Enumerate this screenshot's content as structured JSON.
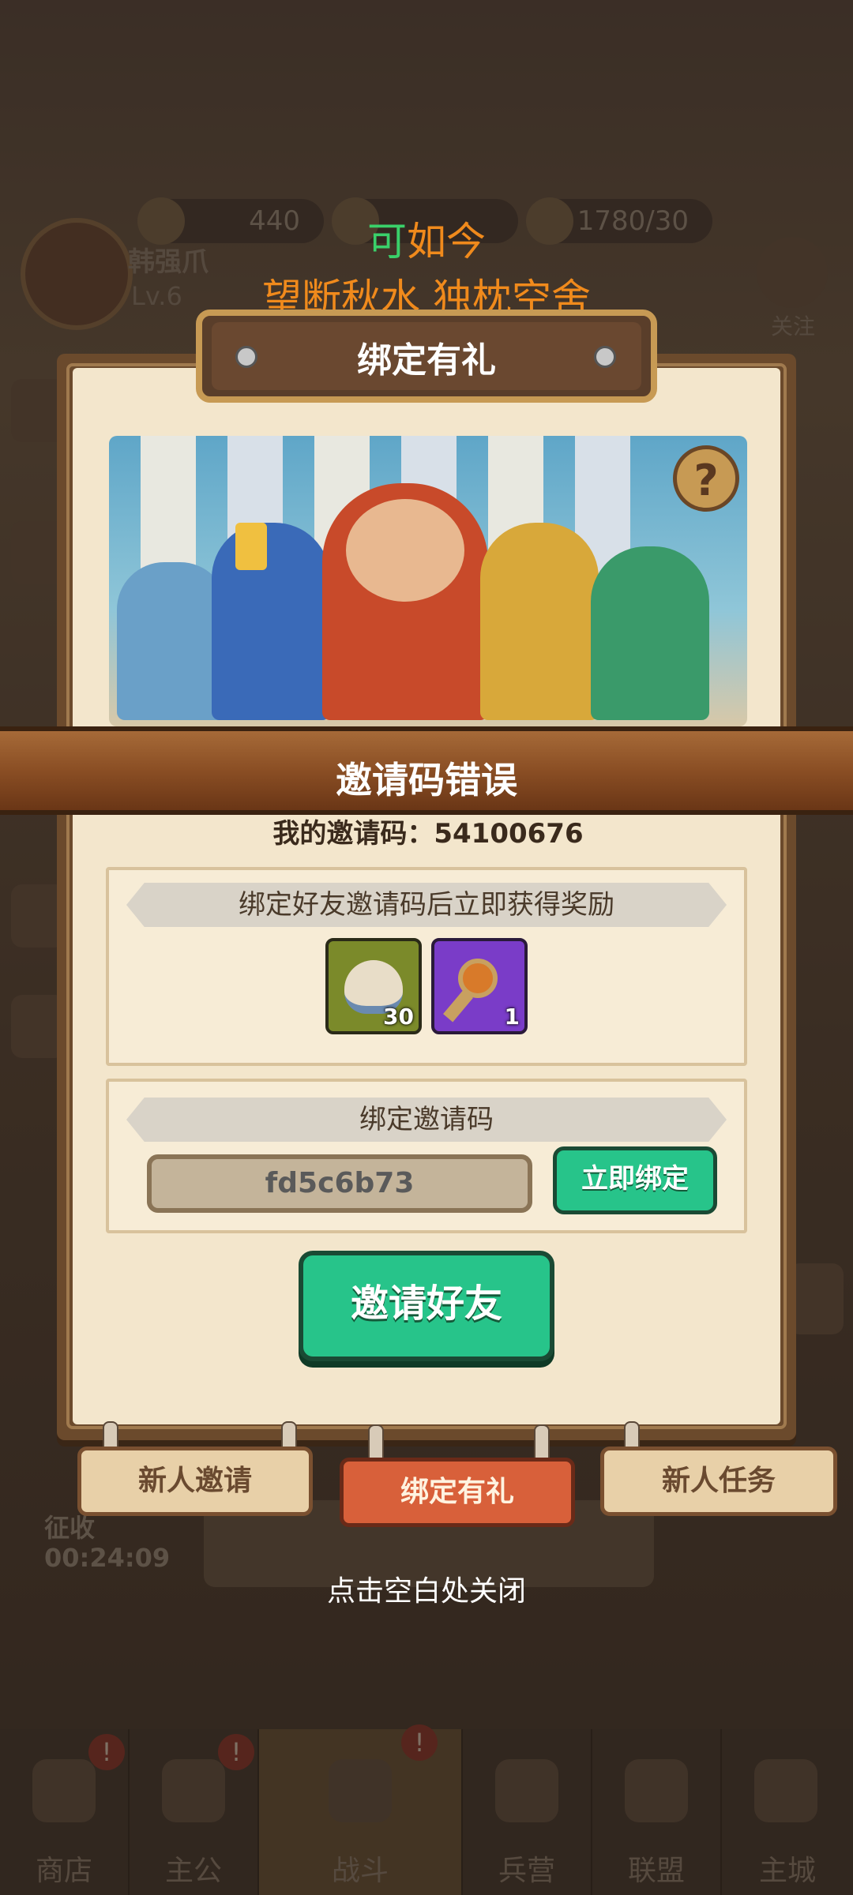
{
  "hud": {
    "player_name": "韩强爪",
    "level": "Lv.6",
    "res_gold": "440",
    "res_food": "1780/30",
    "follow_label": "关注",
    "timer_label": "征收",
    "timer_value": "00:24:09"
  },
  "announce": {
    "line1_prefix": "可",
    "line1_rest": "如今",
    "line2": "望断秋水 独枕空舍"
  },
  "panel": {
    "title": "绑定有礼",
    "help_symbol": "?",
    "error_message": "邀请码错误",
    "my_code": "我的邀请码：54100676",
    "reward_section_title": "绑定好友邀请码后立即获得奖励",
    "rewards": [
      {
        "icon": "rice-bowl-icon",
        "count": "30",
        "bg": "#7b8a2a"
      },
      {
        "icon": "key-icon",
        "count": "1",
        "bg": "#7a3cc8"
      }
    ],
    "bind_section_title": "绑定邀请码",
    "code_input_value": "fd5c6b73",
    "bind_button": "立即绑定",
    "invite_button": "邀请好友"
  },
  "tabs": [
    {
      "label": "新人邀请",
      "active": false
    },
    {
      "label": "绑定有礼",
      "active": true
    },
    {
      "label": "新人任务",
      "active": false
    }
  ],
  "close_hint": "点击空白处关闭",
  "bottom_nav": [
    {
      "label": "商店",
      "icon": "shop-icon",
      "badge": "!"
    },
    {
      "label": "主公",
      "icon": "lord-icon",
      "badge": "!"
    },
    {
      "label": "战斗",
      "icon": "swords-icon",
      "badge": "!"
    },
    {
      "label": "兵营",
      "icon": "barracks-icon",
      "badge": ""
    },
    {
      "label": "联盟",
      "icon": "alliance-icon",
      "badge": ""
    },
    {
      "label": "主城",
      "icon": "city-icon",
      "badge": ""
    }
  ],
  "colors": {
    "accent_green": "#27c48a",
    "announce_orange": "#f08a1c",
    "announce_green": "#3ad06a",
    "panel_bg": "#f3e6cc",
    "error_band": "#8a4e24"
  }
}
